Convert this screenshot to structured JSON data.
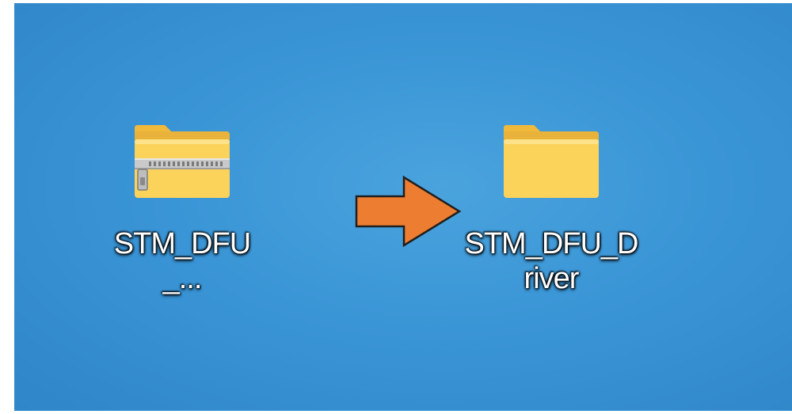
{
  "desktop": {
    "background_color": "#3a95d6",
    "icons": [
      {
        "type": "compressed-folder-icon",
        "label": "STM_DFU_..."
      },
      {
        "type": "folder-icon",
        "label_line1": "STM_DFU_D",
        "label_line2": "river"
      }
    ]
  },
  "annotation": {
    "arrow_icon": "right-arrow-icon",
    "arrow_color": "#ed7d31",
    "arrow_outline": "#1f1f1f"
  },
  "colors": {
    "folder_body": "#fcd35a",
    "folder_back": "#e9b23a",
    "folder_tab": "#f1b93b"
  }
}
